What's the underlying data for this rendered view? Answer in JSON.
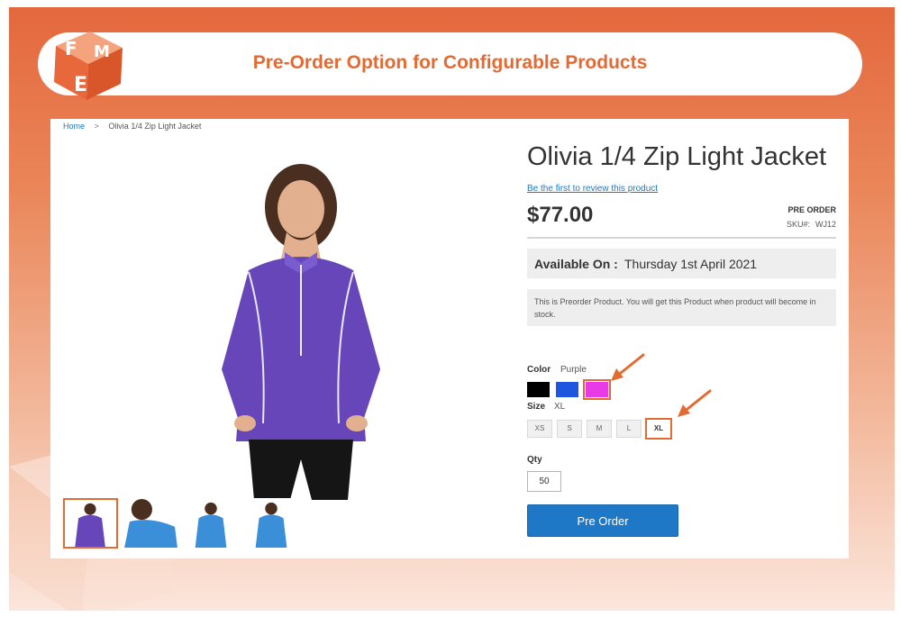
{
  "banner": {
    "title": "Pre-Order Option for Configurable Products",
    "logo_letters": [
      "F",
      "M",
      "E"
    ]
  },
  "breadcrumb": {
    "home": "Home",
    "separator": ">",
    "current": "Olivia 1/4 Zip Light Jacket"
  },
  "product": {
    "title": "Olivia 1/4 Zip Light Jacket",
    "review_link": "Be the first to review this product",
    "price": "$77.00",
    "stock_status": "PRE ORDER",
    "sku_label": "SKU#:",
    "sku_value": "WJ12",
    "available_label": "Available On :",
    "available_date": "Thursday 1st April 2021",
    "notice": "This is Preorder Product. You will get this Product when product will become in stock."
  },
  "options": {
    "color_label": "Color",
    "color_selected": "Purple",
    "color_swatches": [
      {
        "name": "Black",
        "hex": "#000000"
      },
      {
        "name": "Blue",
        "hex": "#1f56e0"
      },
      {
        "name": "Purple",
        "hex": "#e83ae6"
      }
    ],
    "size_label": "Size",
    "size_selected": "XL",
    "sizes": [
      "XS",
      "S",
      "M",
      "L",
      "XL"
    ],
    "qty_label": "Qty",
    "qty_value": "50"
  },
  "actions": {
    "preorder_button": "Pre Order"
  },
  "colors": {
    "accent": "#e36a32",
    "button": "#1f78c6",
    "jacket": "#6646b8",
    "thumb_jacket": "#3a8fd8"
  }
}
